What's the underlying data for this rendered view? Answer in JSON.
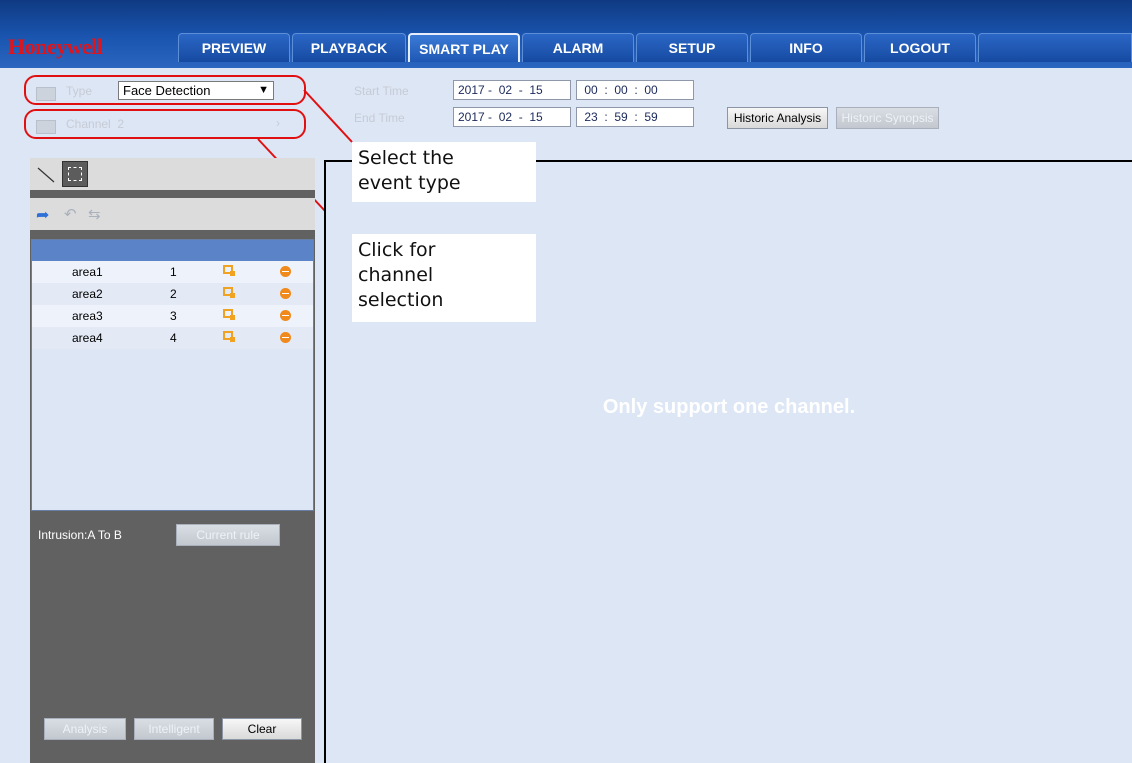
{
  "brand": {
    "logo": "Honeywell",
    "color": "#e1141b"
  },
  "nav": {
    "tabs": [
      {
        "label": "PREVIEW"
      },
      {
        "label": "PLAYBACK"
      },
      {
        "label": "SMART PLAY",
        "active": true
      },
      {
        "label": "ALARM"
      },
      {
        "label": "SETUP"
      },
      {
        "label": "INFO"
      },
      {
        "label": "LOGOUT"
      }
    ]
  },
  "search": {
    "type_label": "Type",
    "type_value": "Face Detection",
    "channel_label": "Channel",
    "channel_value": "2",
    "start_label": "Start Time",
    "start_date": "2017 -  02  -  15",
    "start_time": " 00  :  00  :  00",
    "end_label": "End Time",
    "end_date": "2017 -  02  -  15",
    "end_time": " 23  :  59  :  59",
    "historic_analysis": "Historic Analysis",
    "historic_synopsis": "Historic Synopsis"
  },
  "areas": {
    "rows": [
      {
        "name": "area1",
        "num": "1"
      },
      {
        "name": "area2",
        "num": "2"
      },
      {
        "name": "area3",
        "num": "3"
      },
      {
        "name": "area4",
        "num": "4"
      }
    ]
  },
  "rule": {
    "label": "Intrusion:A To B",
    "current_rule_button": "Current rule"
  },
  "bottom_buttons": {
    "analysis": "Analysis",
    "intelligent": "Intelligent",
    "clear": "Clear"
  },
  "display": {
    "message": "Only support one channel."
  },
  "callouts": {
    "event_type": "Select the\nevent type",
    "channel": "Click for\nchannel\nselection"
  },
  "colors": {
    "header": "#1a55b0",
    "annotation": "#e01010",
    "panel": "#616161"
  }
}
